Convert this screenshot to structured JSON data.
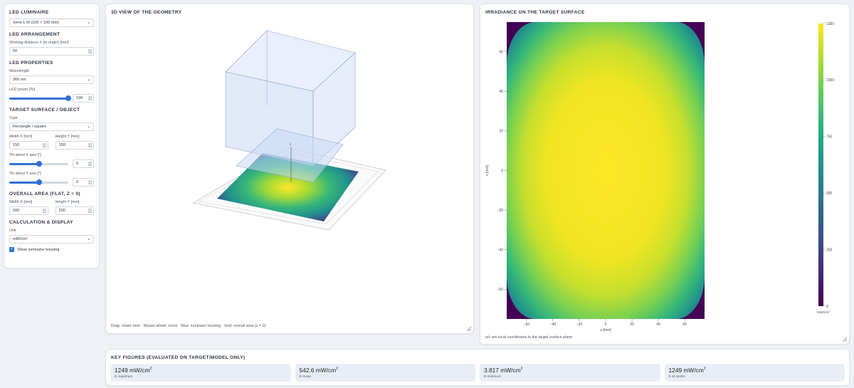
{
  "left": {
    "luminaire": {
      "title": "LED luminaire",
      "selected": "Serie L M (100 × 100 mm)"
    },
    "arrangement": {
      "title": "LED arrangement",
      "distance_label": "Working distance h (to origin) [mm]",
      "distance_value": "50"
    },
    "properties": {
      "title": "LED properties",
      "wavelength_label": "Wavelength",
      "wavelength_value": "365 nm",
      "power_label": "LED power [%]",
      "power_value": "100",
      "power_fraction": 1.0
    },
    "target": {
      "title": "Target surface / object",
      "type_label": "Type",
      "type_value": "Rectangle / square",
      "width_label": "Width X [mm]",
      "width_value": "150",
      "height_label": "Height Y [mm]",
      "height_value": "150",
      "tiltx_label": "Tilt about X axis [°]",
      "tiltx_value": "0",
      "tilty_label": "Tilt about Y axis [°]",
      "tilty_value": "0"
    },
    "overall": {
      "title": "Overall area (flat, Z = 0)",
      "width_label": "Width X [mm]",
      "width_value": "200",
      "height_label": "Height Y [mm]",
      "height_value": "200"
    },
    "calc": {
      "title": "Calculation & display",
      "unit_label": "Unit",
      "unit_value": "mW/cm²",
      "housing_label": "Show luminaire housing",
      "housing_checked": true
    }
  },
  "view3d": {
    "title": "3D view of the geometry",
    "axis_label": "z",
    "note": "Drag: rotate view · Mouse wheel: zoom · Blue: luminaire housing · Grid: overall area (z = 0)"
  },
  "irr": {
    "title": "Irradiance on the target surface",
    "note": "u/v are local coordinates in the target surface plane",
    "xlabel": "u [mm]",
    "ylabel": "v [mm]",
    "x_ticks": [
      "−60",
      "−40",
      "−20",
      "0",
      "20",
      "40",
      "60"
    ],
    "y_ticks": [
      "60",
      "40",
      "20",
      "0",
      "−20",
      "−40",
      "−60"
    ],
    "cb_ticks": [
      "1250",
      "1000",
      "750",
      "500",
      "250",
      "0"
    ],
    "cb_unit": "mW/cm²"
  },
  "chart_data": {
    "type": "heatmap",
    "xlabel": "u [mm]",
    "ylabel": "v [mm]",
    "xlim": [
      -75,
      75
    ],
    "ylim": [
      -75,
      75
    ],
    "colorbar": {
      "min": 0,
      "max": 1250,
      "unit": "mW/cm²"
    },
    "colormap": "viridis",
    "peak": 1249,
    "centre": 1249
  },
  "keys": {
    "title": "Key figures (evaluated on target/model only)",
    "cards": [
      {
        "value": "1249 mW/cm",
        "sup": "2",
        "label": "E maximum"
      },
      {
        "value": "542.6 mW/cm",
        "sup": "2",
        "label": "E mean"
      },
      {
        "value": "3.817 mW/cm",
        "sup": "2",
        "label": "E minimum"
      },
      {
        "value": "1249 mW/cm",
        "sup": "2",
        "label": "E at centre"
      }
    ]
  },
  "colors": {
    "accent": "#2f6fd6",
    "housing": "#c9d8f5"
  }
}
